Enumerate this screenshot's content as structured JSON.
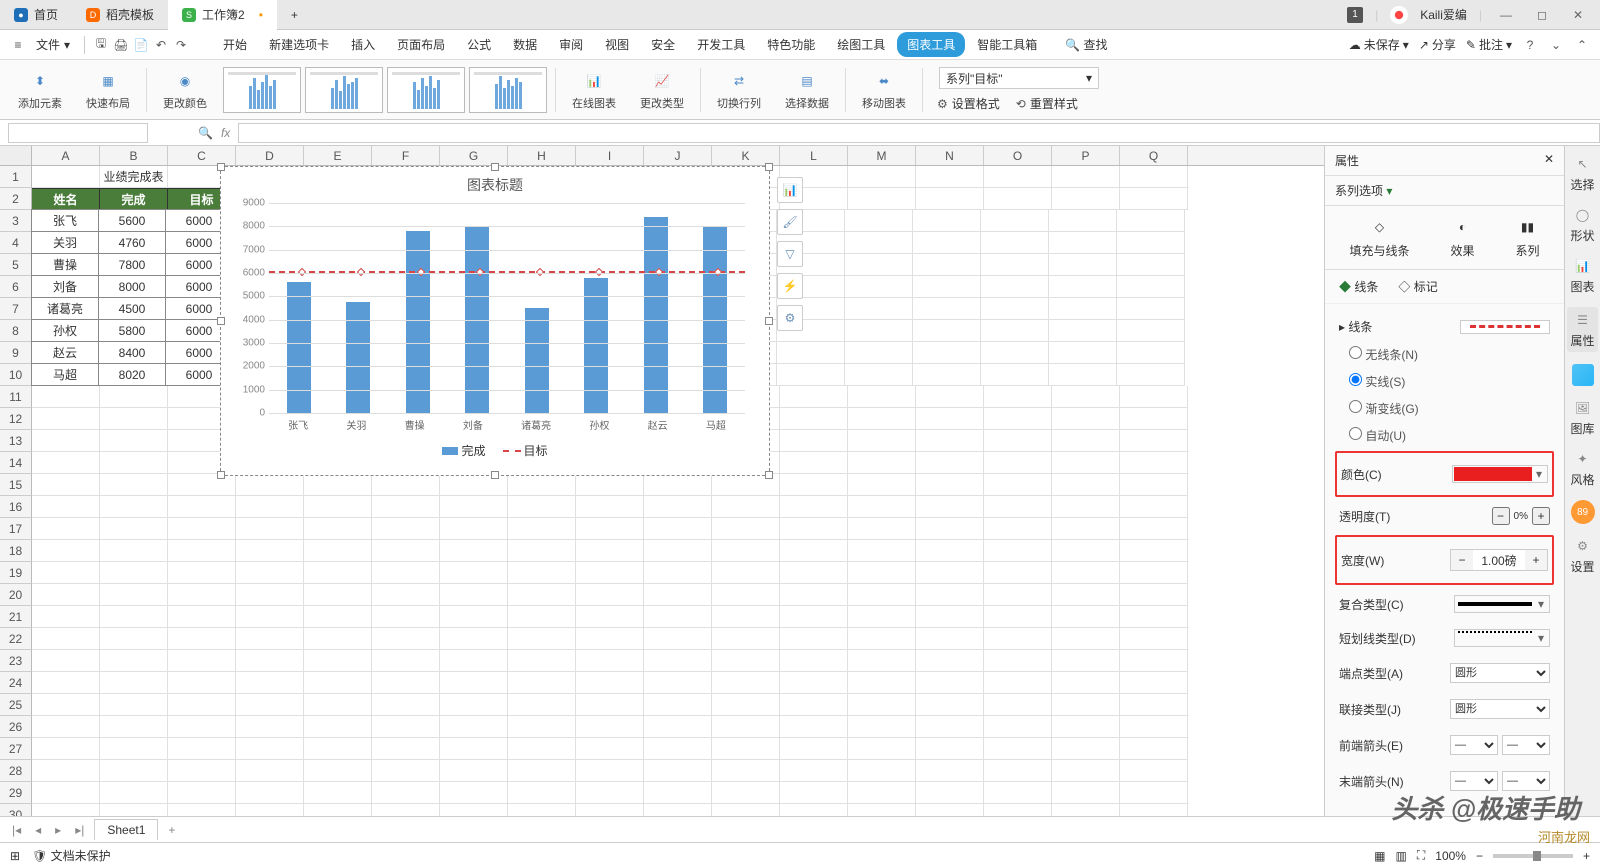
{
  "titlebar": {
    "tabs": [
      {
        "label": "首页",
        "color": "#1e6fb8"
      },
      {
        "label": "稻壳模板",
        "color": "#ff6a00"
      },
      {
        "label": "工作簿2",
        "color": "#3cb04a",
        "active": true
      }
    ],
    "count_badge": "1",
    "user": "Kaili爱编"
  },
  "menubar": {
    "file": "文件",
    "tabs": [
      "开始",
      "新建选项卡",
      "插入",
      "页面布局",
      "公式",
      "数据",
      "审阅",
      "视图",
      "安全",
      "开发工具",
      "特色功能",
      "绘图工具",
      "图表工具",
      "智能工具箱"
    ],
    "active_tab": "图表工具",
    "search": "查找",
    "right": [
      "未保存",
      "分享",
      "批注"
    ]
  },
  "ribbon": {
    "g1": "添加元素",
    "g2": "快速布局",
    "g3": "更改颜色",
    "g4": "在线图表",
    "g5": "更改类型",
    "g6": "切换行列",
    "g7": "选择数据",
    "g8": "移动图表",
    "txt1": "设置格式",
    "txt2": "重置样式",
    "series_sel": "系列\"目标\""
  },
  "formula": {
    "fx": "fx"
  },
  "columns": [
    "A",
    "B",
    "C",
    "D",
    "E",
    "F",
    "G",
    "H",
    "I",
    "J",
    "K",
    "L",
    "M",
    "N",
    "O",
    "P",
    "Q"
  ],
  "row_count": 31,
  "table": {
    "title": "业绩完成表",
    "headers": [
      "姓名",
      "完成",
      "目标"
    ],
    "rows": [
      [
        "张飞",
        "5600",
        "6000"
      ],
      [
        "关羽",
        "4760",
        "6000"
      ],
      [
        "曹操",
        "7800",
        "6000"
      ],
      [
        "刘备",
        "8000",
        "6000"
      ],
      [
        "诸葛亮",
        "4500",
        "6000"
      ],
      [
        "孙权",
        "5800",
        "6000"
      ],
      [
        "赵云",
        "8400",
        "6000"
      ],
      [
        "马超",
        "8020",
        "6000"
      ]
    ]
  },
  "chart_data": {
    "type": "bar",
    "title": "图表标题",
    "categories": [
      "张飞",
      "关羽",
      "曹操",
      "刘备",
      "诸葛亮",
      "孙权",
      "赵云",
      "马超"
    ],
    "series": [
      {
        "name": "完成",
        "values": [
          5600,
          4760,
          7800,
          8000,
          4500,
          5800,
          8400,
          8020
        ]
      },
      {
        "name": "目标",
        "values": [
          6000,
          6000,
          6000,
          6000,
          6000,
          6000,
          6000,
          6000
        ]
      }
    ],
    "ylim": [
      0,
      9000
    ],
    "ystep": 1000,
    "legend": [
      "完成",
      "目标"
    ]
  },
  "rightpane": {
    "head": "属性",
    "selector": "系列选项",
    "tabs": [
      "填充与线条",
      "效果",
      "系列"
    ],
    "subtabs": [
      "线条",
      "标记"
    ],
    "section": "线条",
    "radios": [
      "无线条(N)",
      "实线(S)",
      "渐变线(G)",
      "自动(U)"
    ],
    "radio_checked": 1,
    "color_lbl": "颜色(C)",
    "color_val": "#e91e1e",
    "trans_lbl": "透明度(T)",
    "trans_val": "0%",
    "width_lbl": "宽度(W)",
    "width_val": "1.00磅",
    "compound_lbl": "复合类型(C)",
    "dash_lbl": "短划线类型(D)",
    "cap_lbl": "端点类型(A)",
    "cap_val": "圆形",
    "join_lbl": "联接类型(J)",
    "join_val": "圆形",
    "arrow1_lbl": "前端箭头(E)",
    "arrow2_lbl": "末端箭头(N)"
  },
  "farright": [
    "选择",
    "形状",
    "图表",
    "属性",
    "图库",
    "风格",
    "设置"
  ],
  "farright_badge": "89",
  "sheettab": "Sheet1",
  "status": {
    "protect": "文档未保护",
    "zoom": "100%"
  },
  "watermark": "头杀 @极速手助",
  "watermark2": "河南龙网"
}
